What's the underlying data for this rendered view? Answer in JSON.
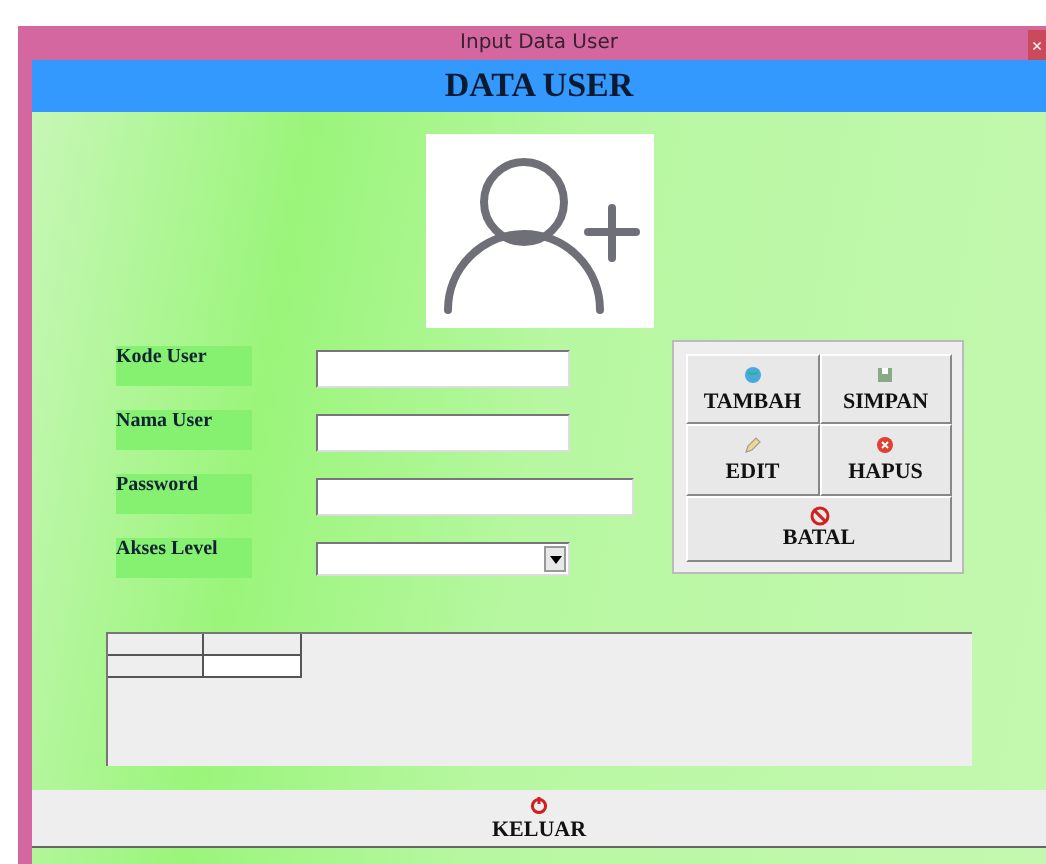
{
  "window": {
    "title": "Input Data User",
    "close": "×"
  },
  "header": "DATA USER",
  "fields": [
    {
      "label": "Kode User",
      "kind": "text"
    },
    {
      "label": "Nama User",
      "kind": "text"
    },
    {
      "label": "Password",
      "kind": "password"
    },
    {
      "label": "Akses Level",
      "kind": "combo"
    }
  ],
  "buttons": [
    {
      "label": "TAMBAH"
    },
    {
      "label": "SIMPAN"
    },
    {
      "label": "EDIT"
    },
    {
      "label": "HAPUS"
    },
    {
      "label": "BATAL"
    }
  ],
  "exit_button": {
    "label": "KELUAR"
  }
}
